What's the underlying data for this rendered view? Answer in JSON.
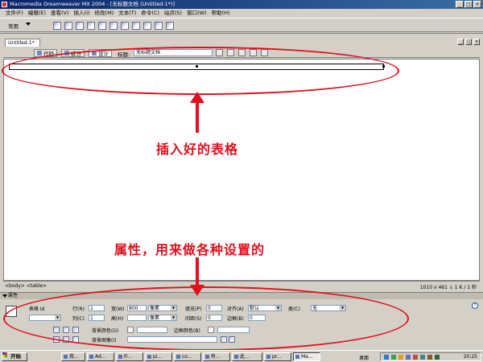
{
  "app": {
    "title": "Macromedia Dreamweaver MX 2004 - [无标题文档 (Untitled-1*)]",
    "window_buttons": [
      "_",
      "□",
      "×"
    ]
  },
  "menu": [
    "文件(F)",
    "编辑(E)",
    "查看(V)",
    "插入(I)",
    "修改(M)",
    "文本(T)",
    "命令(C)",
    "站点(S)",
    "窗口(W)",
    "帮助(H)"
  ],
  "insert_bar": {
    "category": "常用"
  },
  "document": {
    "tab": "Untitled-1*",
    "view_code": "代码",
    "view_split": "拆分",
    "view_design": "设计",
    "title_label": "标题:",
    "title_value": "无标题文档",
    "tag_selector": "<body> <table>",
    "doc_size": "1010 x 461 ↓ 1 K / 1 秒"
  },
  "annotations": {
    "table_label": "插入好的表格",
    "props_label": "属性，用来做各种设置的",
    "color": "#e0101c"
  },
  "properties": {
    "header": "属性",
    "table_id_label": "表格 Id",
    "rows_label": "行(R)",
    "rows_value": "1",
    "cols_label": "列(C)",
    "cols_value": "1",
    "width_label": "宽(W)",
    "width_value": "800",
    "width_unit": "像素",
    "height_label": "高(H)",
    "height_value": "",
    "height_unit": "像素",
    "padding_label": "填充(P)",
    "padding_value": "0",
    "spacing_label": "间距(S)",
    "spacing_value": "0",
    "align_label": "对齐(A)",
    "align_value": "默认",
    "border_label": "边框(B)",
    "border_value": "0",
    "class_label": "类(C)",
    "class_value": "无",
    "bg_color_label": "背景颜色(G)",
    "border_color_label": "边框颜色(B)",
    "bg_image_label": "背景图像(I)"
  },
  "taskbar": {
    "start": "开始",
    "tasks": [
      "我...",
      "Ad...",
      "Fi...",
      "pi...",
      "co...",
      "有...",
      "此...",
      "pr...",
      "Ma..."
    ],
    "desktop_label": "桌面",
    "clock": "20:25"
  }
}
